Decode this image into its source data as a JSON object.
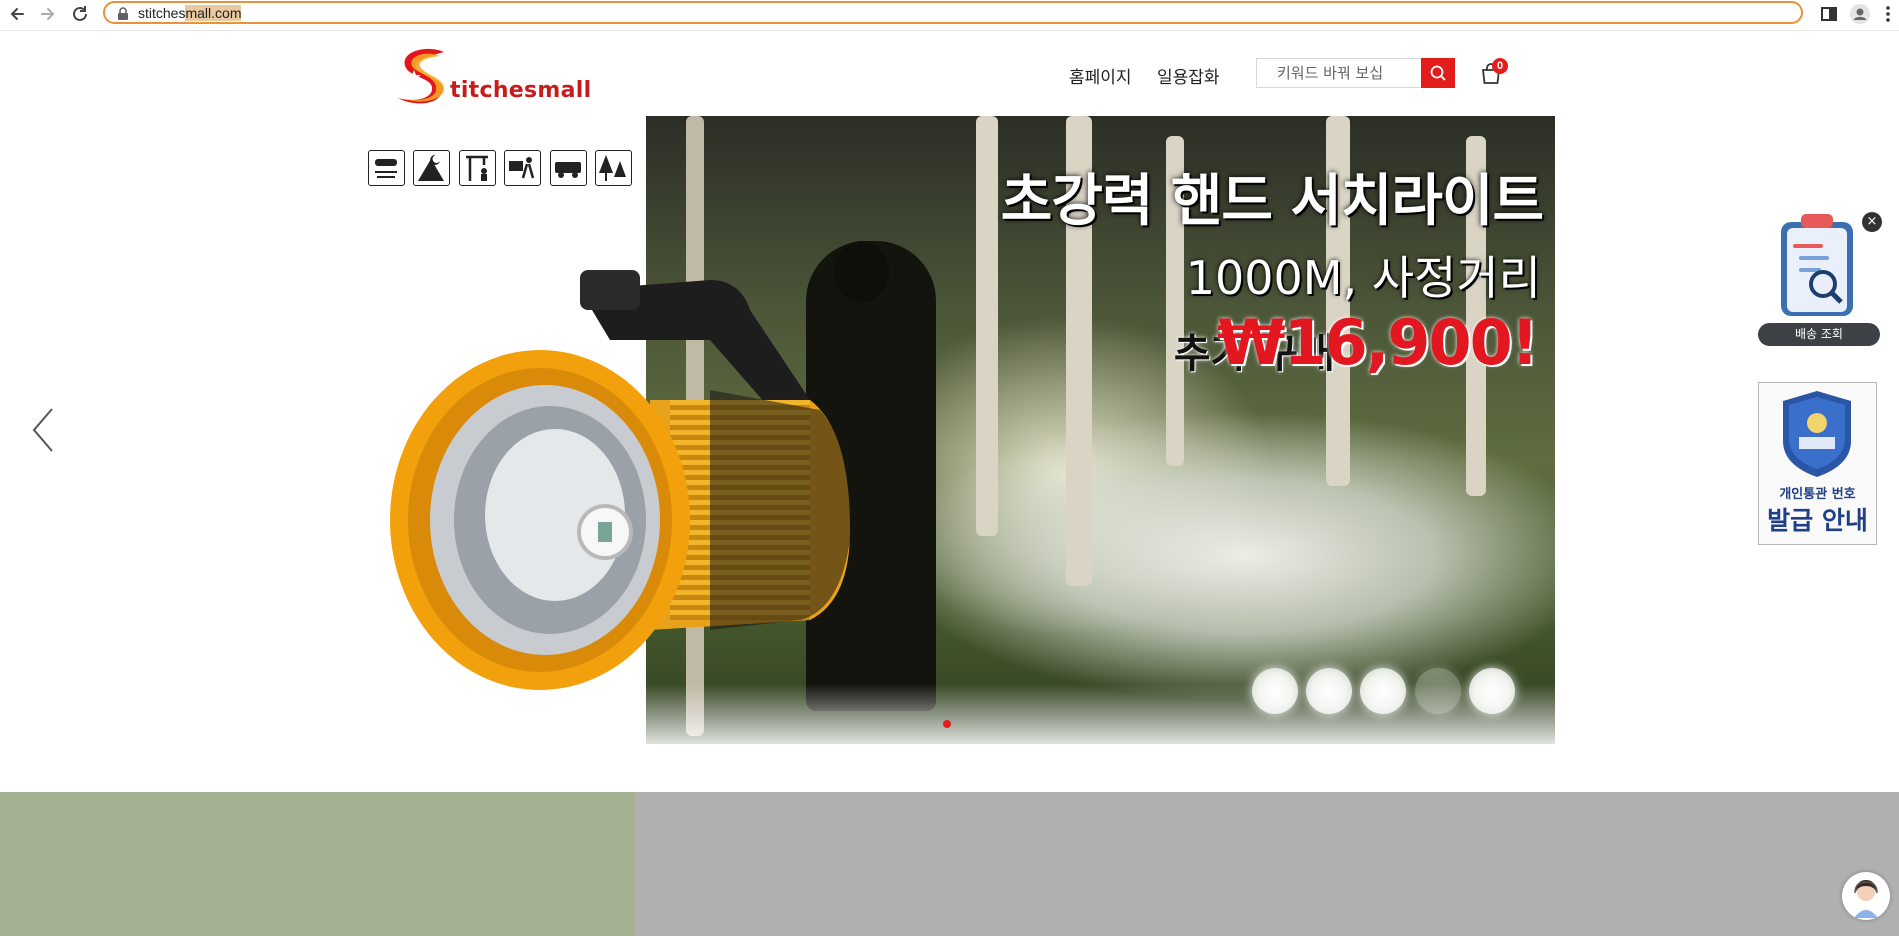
{
  "browser": {
    "url_prefix": "stitches",
    "url_selected": "mall.com"
  },
  "header": {
    "logo_text": "titchesmall",
    "nav": [
      "홈페이지",
      "일용잡화"
    ],
    "search_placeholder": "키워드 바꿔 보십",
    "cart_count": "0"
  },
  "banner": {
    "title": "초강력 핸드 서치라이트",
    "subtitle": "1000M, 사정거리",
    "price_label": "추가 구매",
    "price": "₩16,900!",
    "active_slide": 1
  },
  "widgets": {
    "delivery_label": "배송 조회",
    "customs_line1": "개인통관 번호",
    "customs_line2": "발급 안내",
    "close_icon": "×"
  },
  "colors": {
    "accent": "#e41c1c",
    "omnibox_focus": "#e8903a",
    "bottom_left": "#a3b092",
    "bottom_right": "#b0b0b0"
  }
}
